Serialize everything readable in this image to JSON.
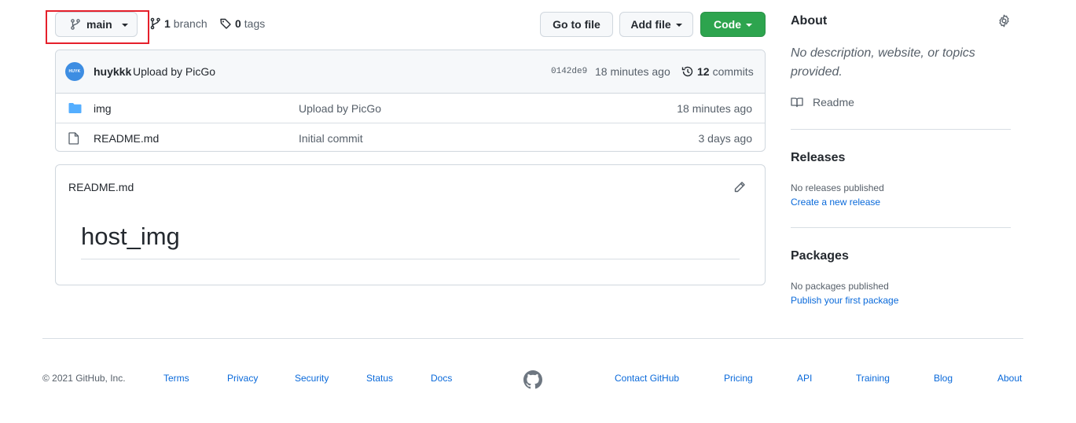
{
  "toolbar": {
    "branch_name": "main",
    "branches_count": "1",
    "branches_label": "branch",
    "tags_count": "0",
    "tags_label": "tags",
    "go_to_file": "Go to file",
    "add_file": "Add file",
    "code": "Code"
  },
  "latest_commit": {
    "avatar_text": "HUYK",
    "author": "huykkk",
    "message": "Upload by PicGo",
    "sha": "0142de9",
    "time": "18 minutes ago",
    "commits_count": "12",
    "commits_label": "commits"
  },
  "files": [
    {
      "name": "img",
      "type": "folder",
      "message": "Upload by PicGo",
      "age": "18 minutes ago"
    },
    {
      "name": "README.md",
      "type": "file",
      "message": "Initial commit",
      "age": "3 days ago"
    }
  ],
  "readme": {
    "filename": "README.md",
    "heading": "host_img"
  },
  "sidebar": {
    "about_title": "About",
    "about_description": "No description, website, or topics provided.",
    "readme_link": "Readme",
    "releases_title": "Releases",
    "releases_empty": "No releases published",
    "releases_link": "Create a new release",
    "packages_title": "Packages",
    "packages_empty": "No packages published",
    "packages_link": "Publish your first package"
  },
  "footer": {
    "copyright": "© 2021 GitHub, Inc.",
    "left_links": [
      "Terms",
      "Privacy",
      "Security",
      "Status",
      "Docs"
    ],
    "right_links": [
      "Contact GitHub",
      "Pricing",
      "API",
      "Training",
      "Blog",
      "About"
    ]
  },
  "colors": {
    "accent_link": "#0969da",
    "code_button": "#2da44e",
    "highlight_box": "#e5202b",
    "folder_icon": "#54aeff"
  }
}
